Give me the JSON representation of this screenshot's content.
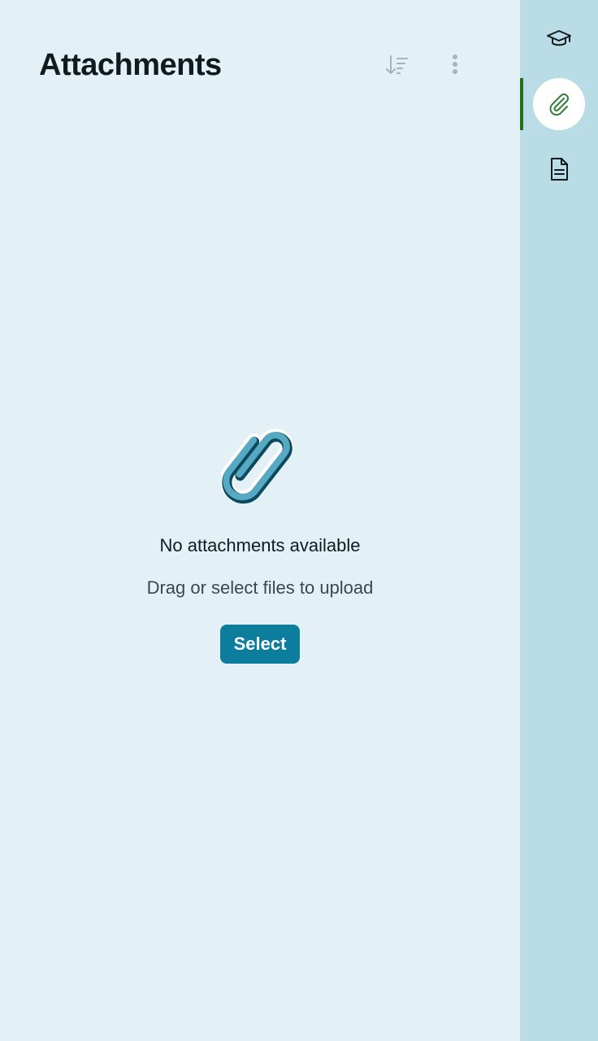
{
  "header": {
    "title": "Attachments",
    "sort_icon": "sort-icon",
    "more_icon": "more-vertical-icon"
  },
  "empty_state": {
    "icon": "paperclip-illustration",
    "title": "No attachments available",
    "subtitle": "Drag or select files to upload",
    "select_label": "Select"
  },
  "rail": {
    "items": [
      {
        "icon": "graduation-cap-icon",
        "active": false
      },
      {
        "icon": "paperclip-icon",
        "active": true
      },
      {
        "icon": "document-icon",
        "active": false
      }
    ]
  },
  "colors": {
    "background": "#e3f1f6",
    "rail_background": "#badce6",
    "primary_button": "#0d7d9e",
    "active_indicator": "#2a6e1c",
    "text": "#111a1c"
  }
}
